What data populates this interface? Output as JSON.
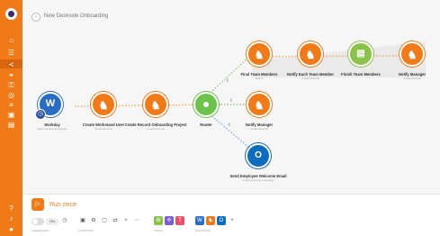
{
  "header": {
    "title": "New Deskside Onboarding"
  },
  "nodes": {
    "workday": {
      "label": "Workday",
      "sub": "Watch for New Employees"
    },
    "create_workstand": {
      "label": "Create Workstand User",
      "sub": "Create Records"
    },
    "create_record": {
      "label": "Create Record Onboarding Project",
      "sub": "Create Records"
    },
    "router": {
      "label": "Router"
    },
    "final_team": {
      "label": "Final Team Members",
      "sub": "Search"
    },
    "notify_each": {
      "label": "Notify Each Team Member",
      "sub": "Create Records"
    },
    "finish_team": {
      "label": "Finish Team Members"
    },
    "notify_manager_top": {
      "label": "Notify Manager",
      "sub": "Create Records"
    },
    "notify_manager": {
      "label": "Notify Manager",
      "sub": "Create Records"
    },
    "send_email": {
      "label": "Send Employee Welcome Email",
      "sub": "Create and send a message"
    }
  },
  "toolbar": {
    "run_label": "Run once",
    "caps": [
      "SCHEDULING",
      "CONTROLS",
      "TOOLS",
      "FAVORITES"
    ]
  },
  "colors": {
    "brand": "#f07a18",
    "router": "#6cc24a",
    "workday": "#2b6cc4",
    "outlook": "#0f6cbd"
  }
}
